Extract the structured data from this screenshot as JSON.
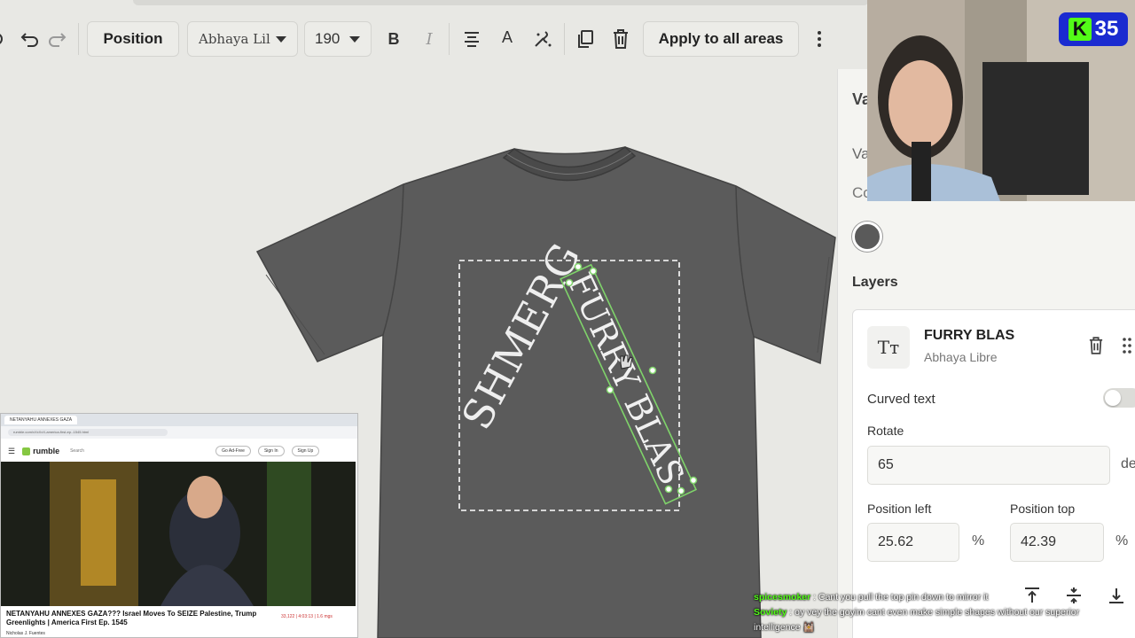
{
  "toolbar": {
    "position_label": "Position",
    "font_value": "Abhaya Lil",
    "size_value": "190",
    "apply_label": "Apply to all areas"
  },
  "design": {
    "text1": "SHMERG",
    "text2": "FURRY BLAS",
    "shirt_color": "#5a5a5a"
  },
  "panel": {
    "partial_label1": "Va",
    "partial_label2": "Va",
    "partial_label3": "Co",
    "swatch_color": "#5a5a5a",
    "layers_heading": "Layers",
    "layer": {
      "type_icon": "Tт",
      "name": "FURRY BLAS",
      "font": "Abhaya Libre",
      "curved_text_label": "Curved text",
      "curved_text_on": false,
      "rotate_label": "Rotate",
      "rotate_value": "65",
      "rotate_unit": "deg",
      "pos_left_label": "Position left",
      "pos_left_value": "25.62",
      "pos_left_unit": "%",
      "pos_top_label": "Position top",
      "pos_top_value": "42.39",
      "pos_top_unit": "%"
    }
  },
  "webcam": {
    "badge_k": "K",
    "badge_num": "35"
  },
  "pip": {
    "tab_label": "NETANYAHU ANNEXES GAZA",
    "url": "rumble.com/vXxXxX-america-first-ep.-1545.html",
    "site_name": "rumble",
    "search_placeholder": "Search",
    "go_adfree": "Go Ad-Free",
    "sign_in": "Sign In",
    "sign_up": "Sign Up",
    "video_title": "NETANYAHU ANNEXES GAZA??? Israel Moves To SEIZE Palestine, Trump Greenlights | America First Ep. 1545",
    "video_meta": "33,122 | 4:03:13 | 1.6 mgs",
    "author": "Nicholas J. Fuentes"
  },
  "chat": [
    {
      "user": "spicesmoker",
      "user_color": "#53fc18",
      "text": "Cant you pull the top pin down to mirror it"
    },
    {
      "user": "Soviety",
      "user_color": "#53fc18",
      "text": "oy vey the goyim cant even make simple shapes without our superior intelligence 🕍"
    }
  ]
}
